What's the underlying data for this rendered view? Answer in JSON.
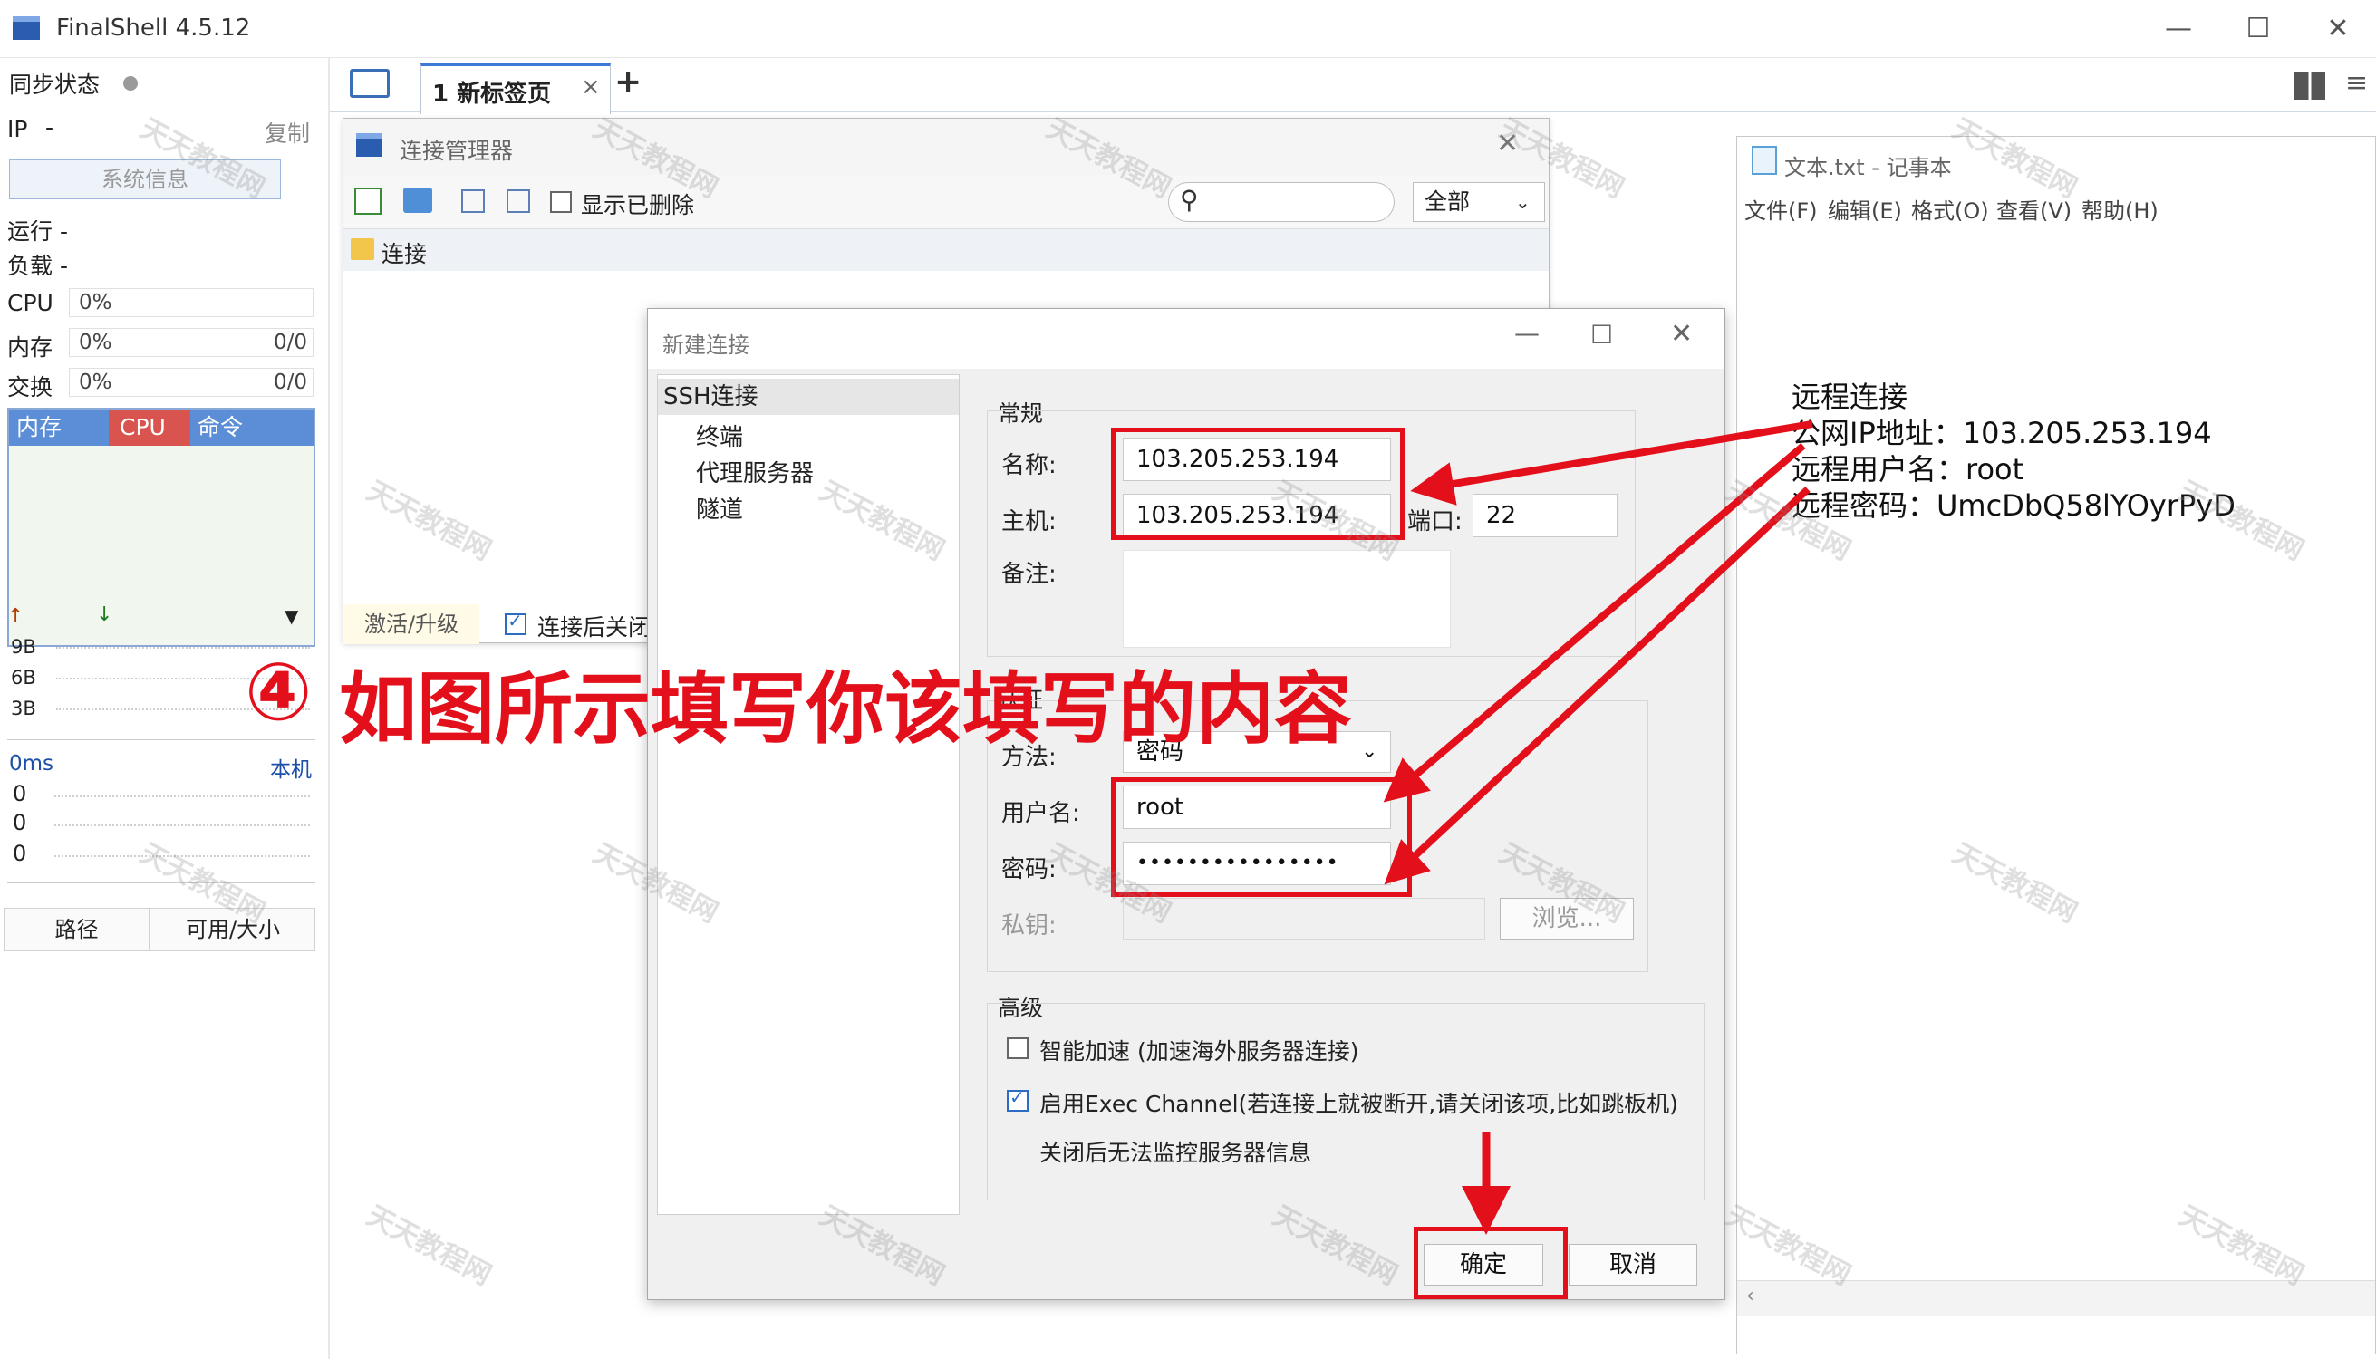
{
  "app": {
    "title": "FinalShell 4.5.12"
  },
  "window_controls": {
    "minimize": "—",
    "maximize": "☐",
    "close": "✕"
  },
  "left_panel": {
    "sync_label": "同步状态",
    "ip_label": "IP",
    "ip_value": "-",
    "copy_label": "复制",
    "sysinfo_button": "系统信息",
    "run_label": "运行 -",
    "load_label": "负载 -",
    "cpu_label": "CPU",
    "cpu_value": "0%",
    "cpu_fraction": 0,
    "mem_label": "内存",
    "mem_value": "0%",
    "mem_count": "0/0",
    "swap_label": "交换",
    "swap_value": "0%",
    "swap_count": "0/0",
    "tabs": [
      "内存",
      "CPU",
      "命令"
    ],
    "net_ticks": [
      "9B",
      "6B",
      "3B"
    ],
    "ping_label": "0ms",
    "ping_host": "本机",
    "ping_ticks": [
      "0",
      "0",
      "0"
    ],
    "disk_headers": [
      "路径",
      "可用/大小"
    ]
  },
  "tabs": {
    "tab1_label": "1 新标签页",
    "tab1_close": "×",
    "add": "+"
  },
  "conn_manager": {
    "title": "连接管理器",
    "show_deleted": "显示已删除",
    "filter_value": "全部",
    "tree_item": "连接",
    "activate": "激活/升级",
    "close_after_connect": "连接后关闭"
  },
  "notepad": {
    "title": "文本.txt - 记事本",
    "menu": [
      "文件(F)",
      "编辑(E)",
      "格式(O)",
      "查看(V)",
      "帮助(H)"
    ],
    "lines": [
      "远程连接",
      "公网IP地址：103.205.253.194",
      "远程用户名：root",
      "远程密码：UmcDbQ58lYOyrPyD"
    ]
  },
  "dialog": {
    "title": "新建连接",
    "nav": [
      "SSH连接",
      "终端",
      "代理服务器",
      "隧道"
    ],
    "general_label": "常规",
    "name_label": "名称:",
    "name_value": "103.205.253.194",
    "host_label": "主机:",
    "host_value": "103.205.253.194",
    "port_label": "端口:",
    "port_value": "22",
    "note_label": "备注:",
    "auth_label": "认证",
    "method_label": "方法:",
    "method_value": "密码",
    "user_label": "用户名:",
    "user_value": "root",
    "pass_label": "密码:",
    "pass_value": "••••••••••••••••",
    "key_label": "私钥:",
    "browse_button": "浏览...",
    "advanced_label": "高级",
    "smart_accel": "智能加速 (加速海外服务器连接)",
    "smart_accel_checked": false,
    "exec_channel": "启用Exec Channel(若连接上就被断开,请关闭该项,比如跳板机)",
    "exec_channel_checked": true,
    "exec_note": "关闭后无法监控服务器信息",
    "ok_button": "确定",
    "cancel_button": "取消"
  },
  "annotation": {
    "step_number": "④",
    "text": "如图所示填写你该填写的内容"
  },
  "watermark": {
    "text": "天天教程网"
  },
  "colors": {
    "accent": "#3b7bd6",
    "annotation_red": "#e3101c",
    "tab_red": "#d9534f"
  }
}
